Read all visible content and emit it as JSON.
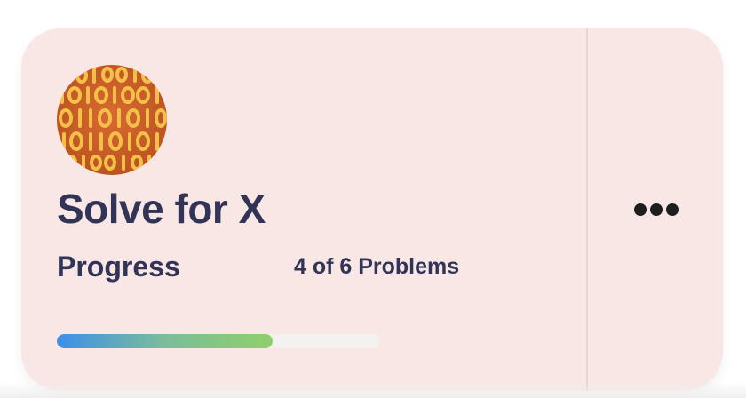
{
  "card": {
    "title": "Solve for X",
    "progress_label": "Progress",
    "progress_count": "4 of 6 Problems",
    "progress_fraction": 0.667,
    "more_icon": "ellipsis-horizontal-icon",
    "avatar_icon": "binary-digits-icon"
  },
  "colors": {
    "card_background": "#f8e7e4",
    "text": "#313357",
    "bar_start": "#3d8fe8",
    "bar_end": "#8fd06a",
    "avatar_orange": "#d0602c",
    "avatar_digits": "#f4c04a"
  }
}
